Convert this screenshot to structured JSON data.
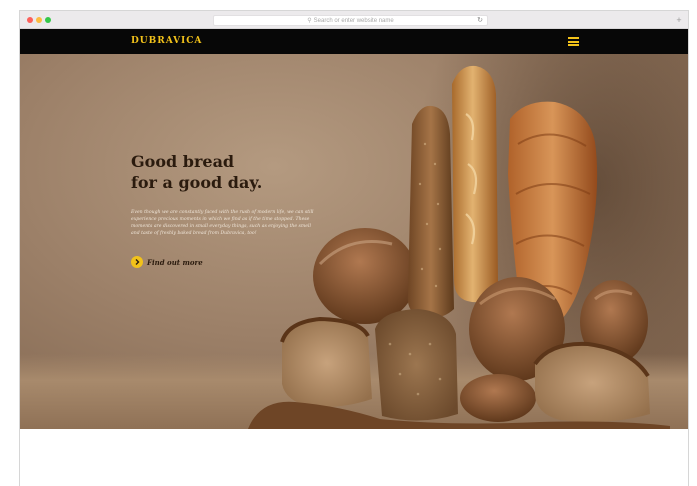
{
  "browser": {
    "address_placeholder": "Search or enter website name",
    "new_tab": "+"
  },
  "site": {
    "logo": "Dubravica"
  },
  "hero": {
    "title_line1": "Good bread",
    "title_line2": "for a good day.",
    "body": "Even though we are constantly faced with the rush of modern life, we can still experience precious moments in which we find as if the time stopped. These moments are discovered in small everyday things, such as enjoying the smell and taste of freshly baked bread from Dubravica, too!",
    "cta_label": "Find out more"
  },
  "colors": {
    "accent": "#f2c21a",
    "navbar": "#070707",
    "title": "#2b1b0e"
  },
  "icons": {
    "cta": "chevron-right-icon",
    "menu": "hamburger-menu-icon",
    "search": "search-icon",
    "reload": "reload-icon"
  }
}
